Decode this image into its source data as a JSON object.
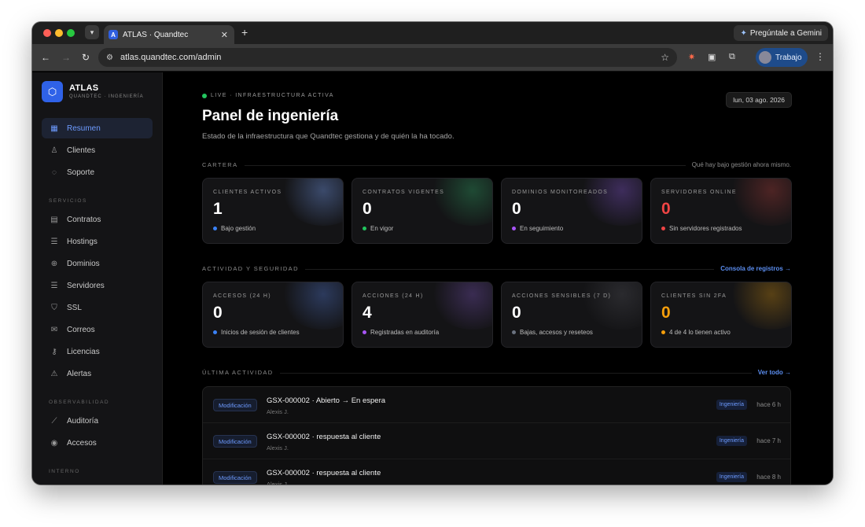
{
  "browser": {
    "tab_title": "ATLAS · Quandtec",
    "favicon_letter": "A",
    "gemini_label": "Pregúntale a Gemini",
    "url": "atlas.quandtec.com/admin",
    "profile_name": "Trabajo"
  },
  "sidebar": {
    "brand": "ATLAS",
    "brand_sub": "QUANDTEC · INGENIERÍA",
    "top_items": [
      {
        "label": "Resumen",
        "icon": "grid-icon",
        "active": true
      },
      {
        "label": "Clientes",
        "icon": "user-icon"
      },
      {
        "label": "Soporte",
        "icon": "chat-icon"
      }
    ],
    "section_servicios": "SERVICIOS",
    "servicios": [
      {
        "label": "Contratos",
        "icon": "document-icon"
      },
      {
        "label": "Hostings",
        "icon": "server-icon"
      },
      {
        "label": "Dominios",
        "icon": "globe-icon"
      },
      {
        "label": "Servidores",
        "icon": "server-icon"
      },
      {
        "label": "SSL",
        "icon": "shield-icon"
      },
      {
        "label": "Correos",
        "icon": "mail-icon"
      },
      {
        "label": "Licencias",
        "icon": "key-icon"
      },
      {
        "label": "Alertas",
        "icon": "alert-icon"
      }
    ],
    "section_observabilidad": "OBSERVABILIDAD",
    "observabilidad": [
      {
        "label": "Auditoría",
        "icon": "chart-icon"
      },
      {
        "label": "Accesos",
        "icon": "eye-icon"
      }
    ],
    "section_interno": "INTERNO"
  },
  "header": {
    "live": "LIVE · INFRAESTRUCTURA ACTIVA",
    "date": "lun, 03 ago. 2026",
    "title": "Panel de ingeniería",
    "subtitle": "Estado de la infraestructura que Quandtec gestiona y de quién la ha tocado."
  },
  "cartera": {
    "title": "CARTERA",
    "hint": "Qué hay bajo gestión ahora mismo.",
    "cards": [
      {
        "label": "CLIENTES ACTIVOS",
        "value": "1",
        "foot": "Bajo gestión",
        "dot": "#3b82f6",
        "value_color": "#ffffff",
        "glow": "#3b4a6b"
      },
      {
        "label": "CONTRATOS VIGENTES",
        "value": "0",
        "foot": "En vigor",
        "dot": "#22c55e",
        "value_color": "#ffffff",
        "glow": "#1f4a34"
      },
      {
        "label": "DOMINIOS MONITOREADOS",
        "value": "0",
        "foot": "En seguimiento",
        "dot": "#a855f7",
        "value_color": "#ffffff",
        "glow": "#3e2d5c"
      },
      {
        "label": "SERVIDORES ONLINE",
        "value": "0",
        "foot": "Sin servidores registrados",
        "dot": "#ef4444",
        "value_color": "#ef4444",
        "glow": "#4d2424"
      }
    ]
  },
  "actividad": {
    "title": "ACTIVIDAD Y SEGURIDAD",
    "link": "Consola de registros →",
    "cards": [
      {
        "label": "ACCESOS (24 H)",
        "value": "0",
        "foot": "Inicios de sesión de clientes",
        "dot": "#3b82f6",
        "value_color": "#ffffff",
        "glow": "#2c3a5c"
      },
      {
        "label": "ACCIONES (24 H)",
        "value": "4",
        "foot": "Registradas en auditoría",
        "dot": "#a855f7",
        "value_color": "#ffffff",
        "glow": "#3a2c52"
      },
      {
        "label": "ACCIONES SENSIBLES (7 D)",
        "value": "0",
        "foot": "Bajas, accesos y reseteos",
        "dot": "#6b7280",
        "value_color": "#ffffff",
        "glow": "#2a2a2e"
      },
      {
        "label": "CLIENTES SIN 2FA",
        "value": "0",
        "foot": "4 de 4 lo tienen activo",
        "dot": "#f59e0b",
        "value_color": "#f59e0b",
        "glow": "#574015"
      }
    ]
  },
  "ultima": {
    "title": "ÚLTIMA ACTIVIDAD",
    "link": "Ver todo →",
    "rows": [
      {
        "badge": "Modificación",
        "title": "GSX-000002 · Abierto → En espera",
        "user": "Alexis J.",
        "tag": "Ingeniería",
        "time": "hace 6 h"
      },
      {
        "badge": "Modificación",
        "title": "GSX-000002 · respuesta al cliente",
        "user": "Alexis J.",
        "tag": "Ingeniería",
        "time": "hace 7 h"
      },
      {
        "badge": "Modificación",
        "title": "GSX-000002 · respuesta al cliente",
        "user": "Alexis J.",
        "tag": "Ingeniería",
        "time": "hace 8 h"
      }
    ]
  }
}
